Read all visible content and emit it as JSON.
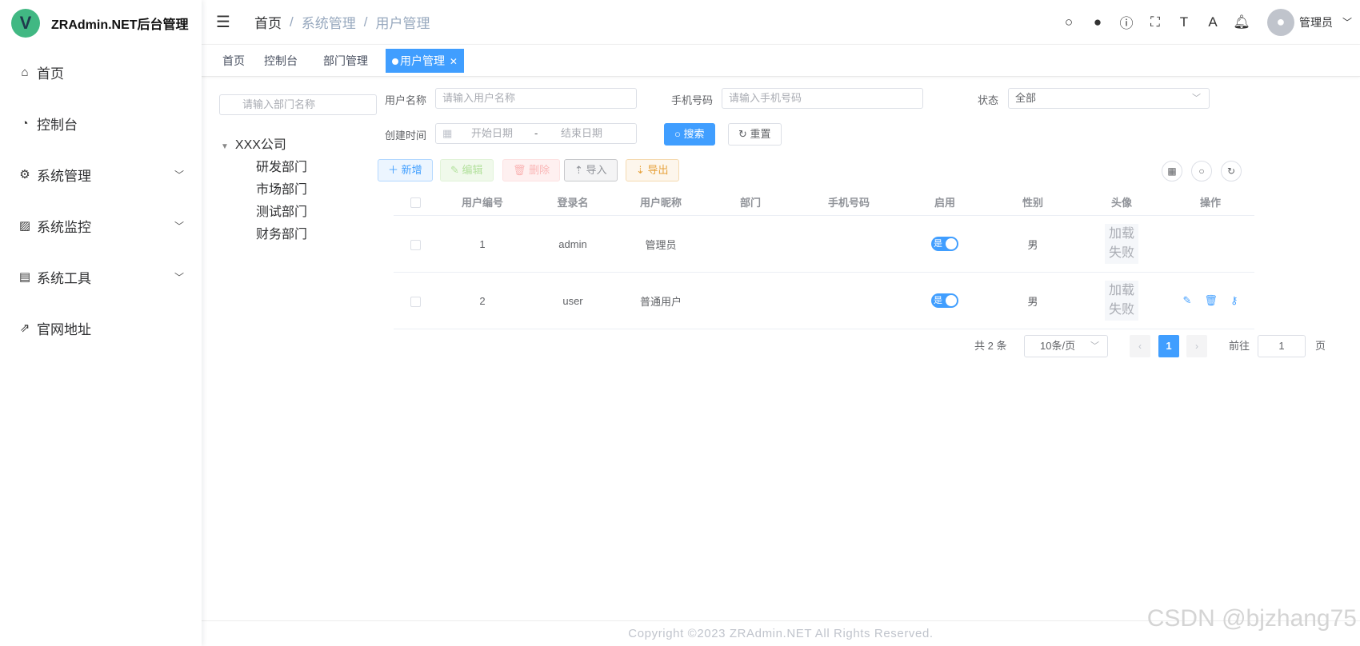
{
  "app": {
    "logo_letter": "V",
    "title": "ZRAdmin.NET后台管理"
  },
  "sidebar": {
    "items": [
      {
        "icon": "⌂",
        "label": "首页",
        "has_children": false
      },
      {
        "icon": "◔",
        "label": "控制台",
        "has_children": false
      },
      {
        "icon": "⚙",
        "label": "系统管理",
        "has_children": true
      },
      {
        "icon": "▨",
        "label": "系统监控",
        "has_children": true
      },
      {
        "icon": "▤",
        "label": "系统工具",
        "has_children": true
      },
      {
        "icon": "⇗",
        "label": "官网地址",
        "has_children": false
      }
    ]
  },
  "navbar": {
    "breadcrumb": [
      "首页",
      "系统管理",
      "用户管理"
    ],
    "user_name": "管理员"
  },
  "tags": [
    "首页",
    "控制台",
    "部门管理",
    "用户管理"
  ],
  "dept": {
    "search_placeholder": "请输入部门名称",
    "root": "XXX公司",
    "children": [
      "研发部门",
      "市场部门",
      "测试部门",
      "财务部门"
    ]
  },
  "search_form": {
    "username_label": "用户名称",
    "username_placeholder": "请输入用户名称",
    "phone_label": "手机号码",
    "phone_placeholder": "请输入手机号码",
    "status_label": "状态",
    "status_value": "全部",
    "created_label": "创建时间",
    "start_placeholder": "开始日期",
    "range_sep": "-",
    "end_placeholder": "结束日期",
    "search_btn": "搜索",
    "reset_btn": "重置"
  },
  "toolbar": {
    "add": "新增",
    "edit": "编辑",
    "delete": "删除",
    "import": "导入",
    "export": "导出"
  },
  "table": {
    "headers": [
      "用户编号",
      "登录名",
      "用户昵称",
      "部门",
      "手机号码",
      "启用",
      "性别",
      "头像",
      "操作"
    ],
    "rows": [
      {
        "id": "1",
        "login": "admin",
        "nick": "管理员",
        "dept": "",
        "phone": "",
        "enabled": "是",
        "gender": "男",
        "avatar_line1": "加载",
        "avatar_line2": "失败"
      },
      {
        "id": "2",
        "login": "user",
        "nick": "普通用户",
        "dept": "",
        "phone": "",
        "enabled": "是",
        "gender": "男",
        "avatar_line1": "加载",
        "avatar_line2": "失败"
      }
    ]
  },
  "pagination": {
    "total": "共 2 条",
    "page_size": "10条/页",
    "current": "1",
    "goto_label": "前往",
    "goto_value": "1",
    "page_suffix": "页"
  },
  "footer": "Copyright ©2023 ZRAdmin.NET All Rights Reserved.",
  "watermark": "CSDN @bjzhang75",
  "colors": {
    "primary": "#409eff",
    "logo": "#41b883"
  }
}
